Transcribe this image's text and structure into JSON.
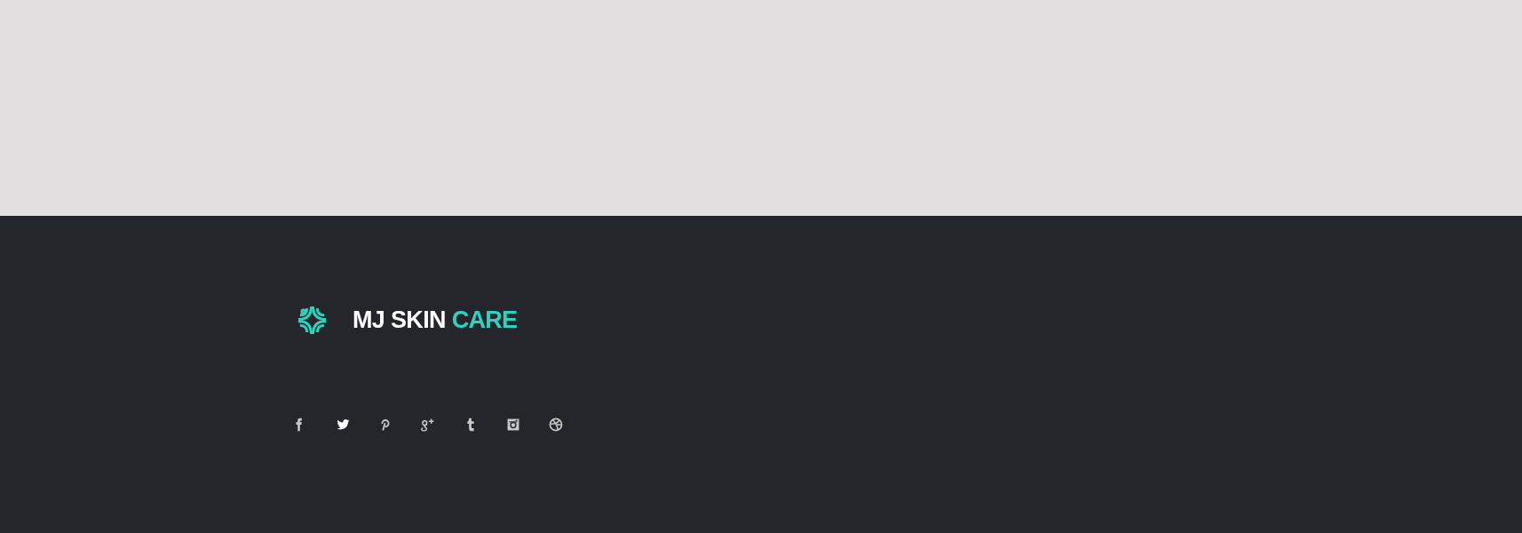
{
  "footer": {
    "logo": {
      "name": "MJ SKIN",
      "accent": "CARE"
    },
    "social_links": [
      {
        "kind": "facebook"
      },
      {
        "kind": "twitter"
      },
      {
        "kind": "pinterest"
      },
      {
        "kind": "googleplus"
      },
      {
        "kind": "tumblr"
      },
      {
        "kind": "instagram"
      },
      {
        "kind": "dribbble"
      }
    ]
  }
}
